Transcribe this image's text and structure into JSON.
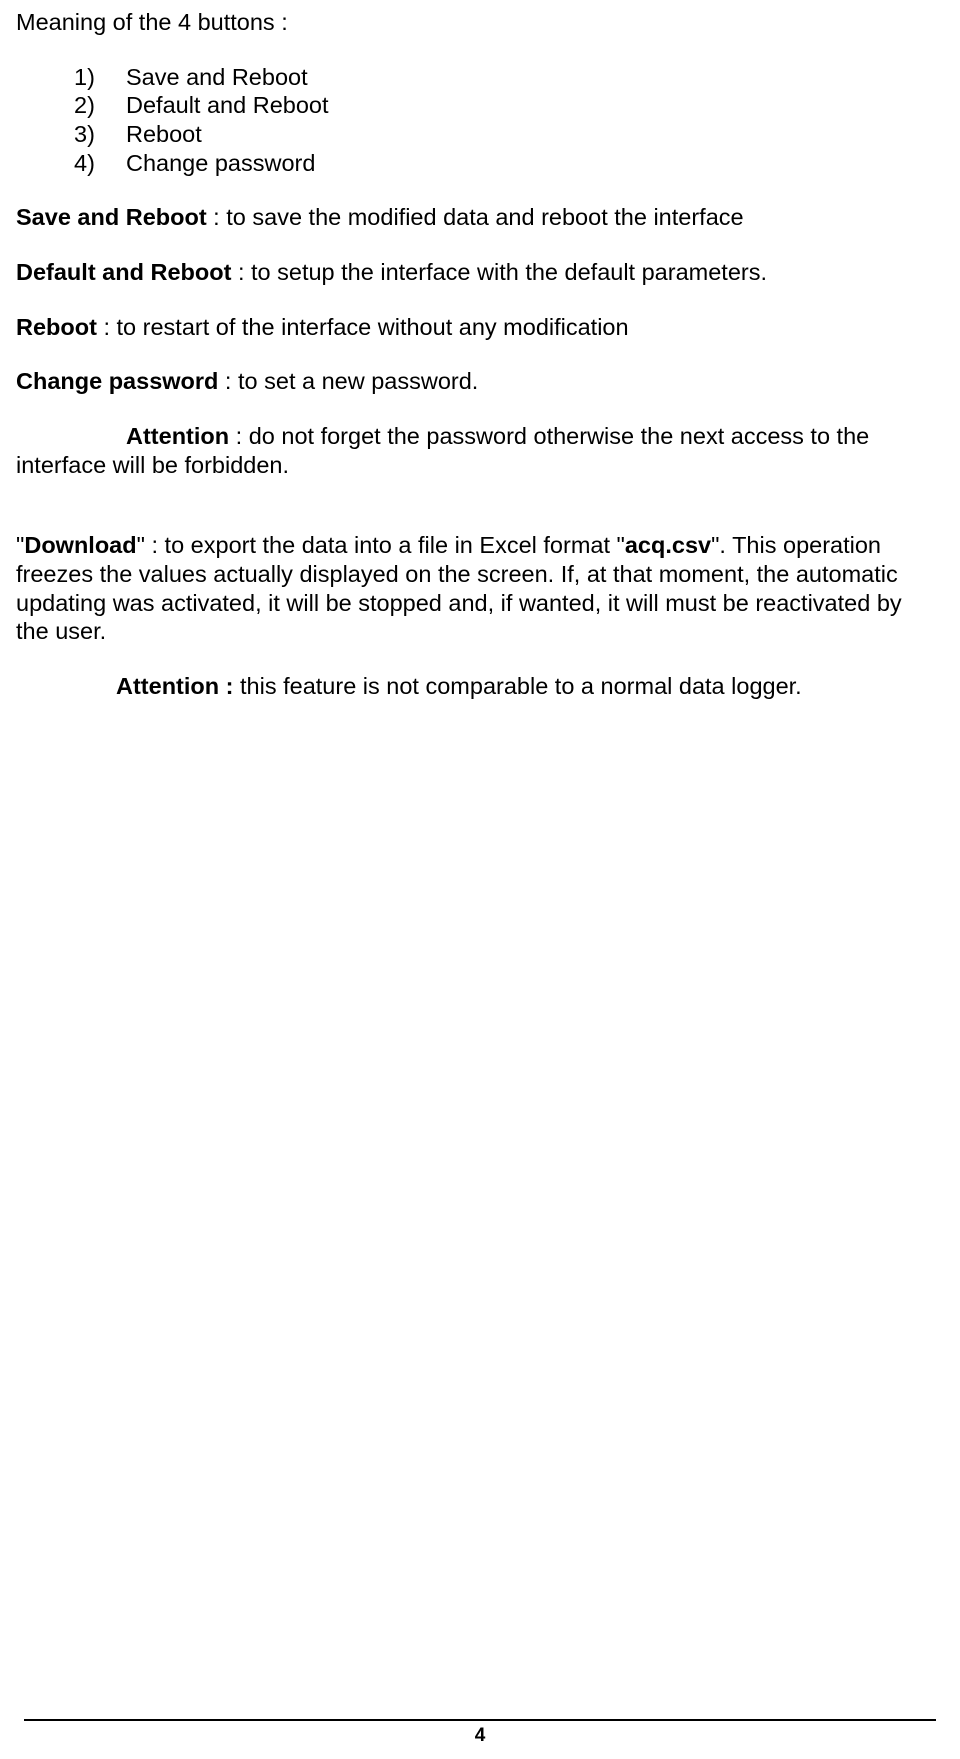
{
  "heading": "Meaning of the 4 buttons :",
  "list": [
    {
      "n": "1)",
      "t": "Save and Reboot"
    },
    {
      "n": "2)",
      "t": "Default and Reboot"
    },
    {
      "n": "3)",
      "t": "Reboot"
    },
    {
      "n": "4)",
      "t": "Change password"
    }
  ],
  "save": {
    "label": "Save and Reboot",
    "text": " : to save the modified data and reboot the interface"
  },
  "default": {
    "label": "Default and Reboot",
    "text": " : to setup the interface with the default parameters."
  },
  "reboot": {
    "label": "Reboot",
    "text": " : to restart of the interface without any modification"
  },
  "change": {
    "label": "Change password",
    "text": " : to set a new password."
  },
  "attention1": {
    "label": "Attention",
    "text": " : do not forget the password otherwise the next access to the interface will be forbidden."
  },
  "download": {
    "pre": "\"",
    "label": "Download",
    "mid": "\" : to export the data into a file in Excel format \"",
    "file": "acq.csv",
    "post": "\". This operation freezes the values actually displayed on the screen. If, at that moment, the automatic updating was activated, it will be stopped and, if wanted, it will must be reactivated by the user."
  },
  "attention2": {
    "label": "Attention :",
    "text": "  this feature is not comparable to a normal data logger."
  },
  "pageNumber": "4"
}
